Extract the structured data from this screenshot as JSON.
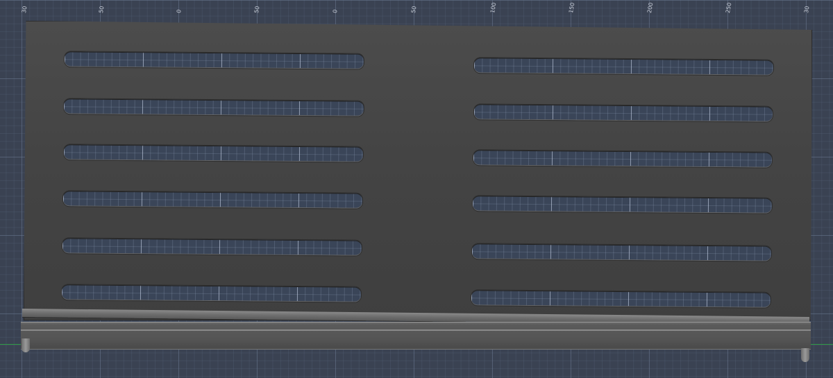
{
  "ruler": {
    "labels": [
      "30",
      "50",
      "0",
      "50",
      "0",
      "50",
      "100",
      "150",
      "200",
      "250",
      "30"
    ]
  },
  "colors": {
    "viewport_background": "#3a4252",
    "panel": "#464646",
    "slot_fill": "#3a4558",
    "rail": "#7a7a7a",
    "axis_x": "#2f9a45"
  },
  "model": {
    "slots_per_column": 6,
    "columns": 2
  }
}
